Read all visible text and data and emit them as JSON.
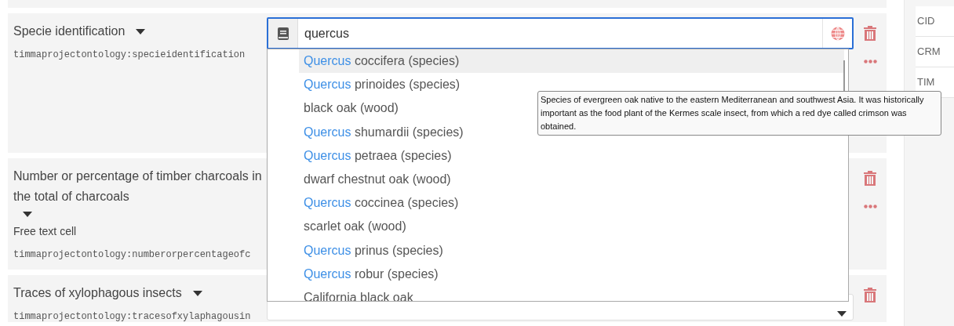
{
  "fields": [
    {
      "kind": "search",
      "label": "Specie identification",
      "property": "timmaprojectontology:specieidentification",
      "value": "quercus",
      "options": [
        {
          "highlight": "Quercus",
          "text": " coccifera (species)",
          "selected": true
        },
        {
          "highlight": "Quercus",
          "text": " prinoides (species)",
          "selected": false
        },
        {
          "text": "black oak (wood)",
          "selected": false
        },
        {
          "highlight": "Quercus",
          "text": " shumardii (species)",
          "selected": false
        },
        {
          "highlight": "Quercus",
          "text": " petraea (species)",
          "selected": false
        },
        {
          "text": "dwarf chestnut oak (wood)",
          "selected": false
        },
        {
          "highlight": "Quercus",
          "text": " coccinea (species)",
          "selected": false
        },
        {
          "text": "scarlet oak (wood)",
          "selected": false
        },
        {
          "highlight": "Quercus",
          "text": " prinus (species)",
          "selected": false
        },
        {
          "highlight": "Quercus",
          "text": " robur (species)",
          "selected": false
        },
        {
          "text": "California black oak",
          "selected": false
        }
      ],
      "tooltip": "Species of evergreen oak native to the eastern Mediterranean and southwest Asia. It was historically important as the food plant of the Kermes scale insect, from which a red dye called crimson was obtained."
    },
    {
      "kind": "text",
      "label": "Number or percentage of timber charcoals in the total of charcoals",
      "note": "Free text cell",
      "property": "timmaprojectontology:numberorpercentageofc"
    },
    {
      "kind": "select",
      "label": "Traces of xylophagous insects",
      "property": "timmaprojectontology:tracesofxylaphagousin"
    }
  ],
  "sidebar": [
    "CID",
    "CRM",
    "TIM"
  ]
}
